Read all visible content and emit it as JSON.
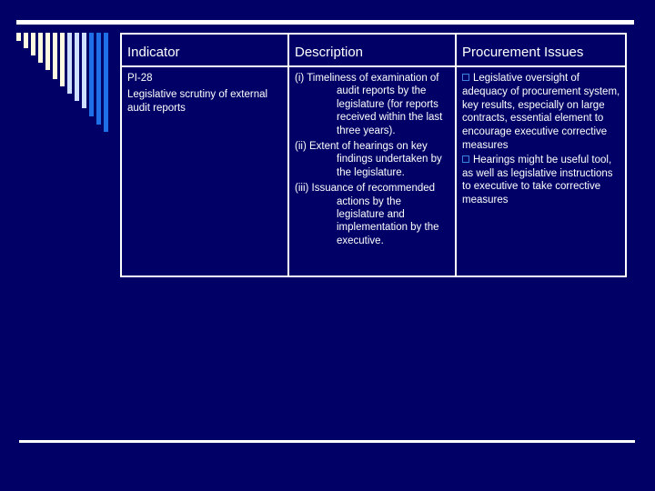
{
  "colors": {
    "background": "#000066",
    "rule": "#ffffff",
    "stripe_cream": "#fffbe0",
    "stripe_light_blue": "#cfe0ff",
    "stripe_blue": "#1f6fe6",
    "bullet": "#3f7fe0"
  },
  "decoration": {
    "stripes": [
      {
        "tone": "cream",
        "top_len": 9
      },
      {
        "tone": "cream",
        "top_len": 17
      },
      {
        "tone": "cream",
        "top_len": 25
      },
      {
        "tone": "cream",
        "top_len": 33
      },
      {
        "tone": "cream",
        "top_len": 41
      },
      {
        "tone": "cream",
        "top_len": 51
      },
      {
        "tone": "cream",
        "top_len": 59
      },
      {
        "tone": "light_blue",
        "top_len": 67
      },
      {
        "tone": "light_blue",
        "top_len": 75
      },
      {
        "tone": "light_blue",
        "top_len": 83
      },
      {
        "tone": "blue",
        "top_len": 92
      },
      {
        "tone": "blue",
        "top_len": 101
      },
      {
        "tone": "blue",
        "top_len": 109
      }
    ]
  },
  "table": {
    "headers": [
      "Indicator",
      "Description",
      "Procurement Issues"
    ],
    "row": {
      "indicator": {
        "code": "PI-28",
        "name": "Legislative scrutiny of external audit reports"
      },
      "description": [
        {
          "first": "(i) Timeliness of examination of",
          "rest": "audit reports by the legislature (for reports received within the last three years)."
        },
        {
          "first": "(ii) Extent of hearings on key",
          "rest": "findings undertaken by the legislature."
        },
        {
          "first": "(iii) Issuance of recommended",
          "rest": "actions by the legislature and implementation by the executive."
        }
      ],
      "procurement_issues": [
        "Legislative oversight of adequacy of procurement system, key results, especially on large contracts, essential element to encourage executive corrective measures",
        "Hearings might be useful tool, as well as legislative instructions to executive to take corrective measures"
      ]
    }
  }
}
